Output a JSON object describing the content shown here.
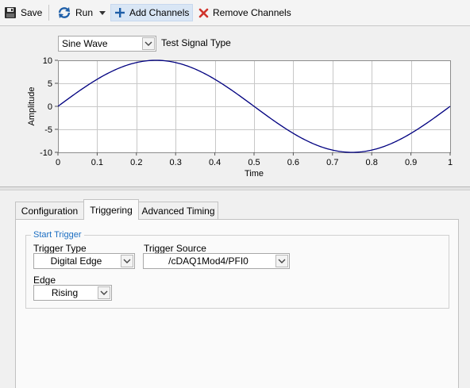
{
  "toolbar": {
    "save_label": "Save",
    "run_label": "Run",
    "add_channels_label": "Add Channels",
    "remove_channels_label": "Remove Channels"
  },
  "signal": {
    "type_value": "Sine Wave",
    "type_label": "Test Signal Type"
  },
  "chart_data": {
    "type": "line",
    "xlabel": "Time",
    "ylabel": "Amplitude",
    "xlim": [
      0,
      1
    ],
    "ylim": [
      -10,
      10
    ],
    "x_ticks": [
      "0",
      "0.1",
      "0.2",
      "0.3",
      "0.4",
      "0.5",
      "0.6",
      "0.7",
      "0.8",
      "0.9",
      "1"
    ],
    "y_ticks": [
      "10",
      "5",
      "0",
      "-5",
      "-10"
    ],
    "grid": true,
    "series": [
      {
        "function": "10*sin(2*pi*t)",
        "amplitude": 10,
        "frequency": 1,
        "color": "#000080"
      }
    ]
  },
  "tabs": [
    {
      "label": "Configuration",
      "active": false
    },
    {
      "label": "Triggering",
      "active": true
    },
    {
      "label": "Advanced Timing",
      "active": false
    }
  ],
  "trigger": {
    "group_title": "Start Trigger",
    "type_label": "Trigger Type",
    "type_value": "Digital Edge",
    "source_label": "Trigger Source",
    "source_value": "/cDAQ1Mod4/PFI0",
    "edge_label": "Edge",
    "edge_value": "Rising"
  },
  "colors": {
    "accent": "#1b6ec2",
    "plot_line": "#000080",
    "grid": "#c8c8c8"
  }
}
